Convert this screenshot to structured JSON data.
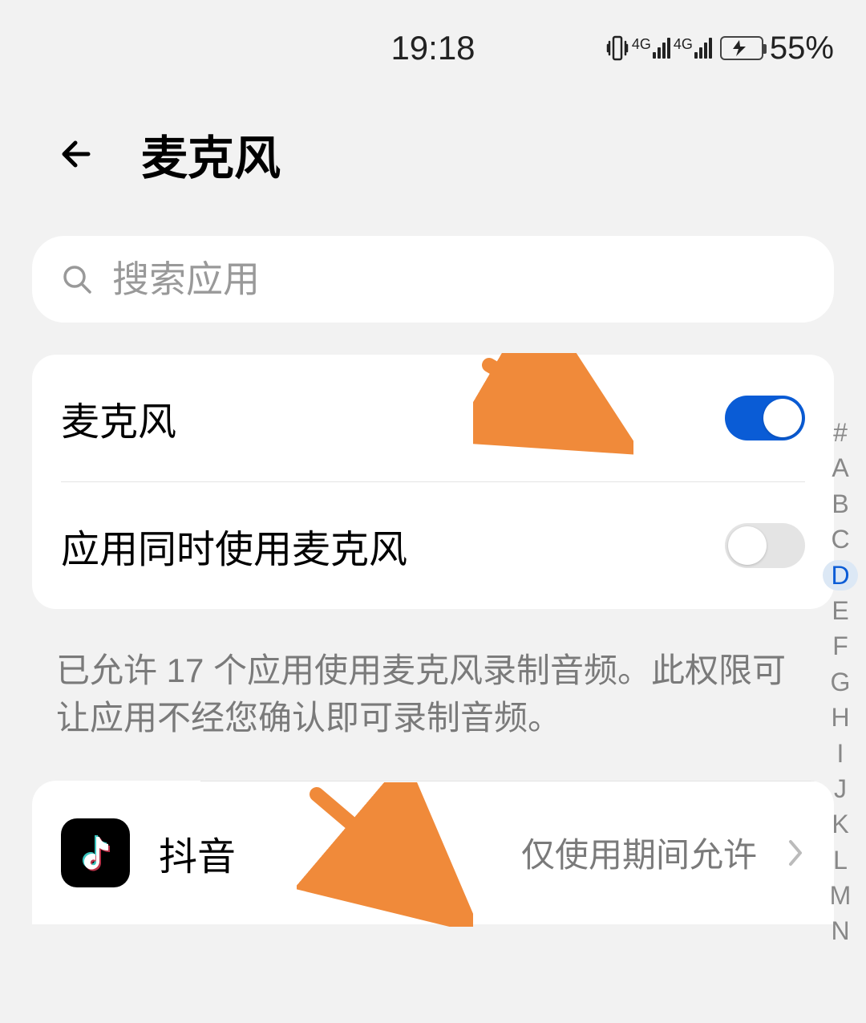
{
  "status": {
    "time": "19:18",
    "battery_pct": "55%",
    "network_label_1": "4G",
    "network_label_2": "4G"
  },
  "header": {
    "title": "麦克风"
  },
  "search": {
    "placeholder": "搜索应用"
  },
  "settings": {
    "mic_label": "麦克风",
    "mic_on": true,
    "simul_label": "应用同时使用麦克风",
    "simul_on": false
  },
  "info_text": "已允许 17 个应用使用麦克风录制音频。此权限可让应用不经您确认即可录制音频。",
  "apps": [
    {
      "name": "抖音",
      "status": "仅使用期间允许"
    }
  ],
  "index": {
    "letters": [
      "#",
      "A",
      "B",
      "C",
      "D",
      "E",
      "F",
      "G",
      "H",
      "I",
      "J",
      "K",
      "L",
      "M",
      "N"
    ],
    "active": "D"
  }
}
